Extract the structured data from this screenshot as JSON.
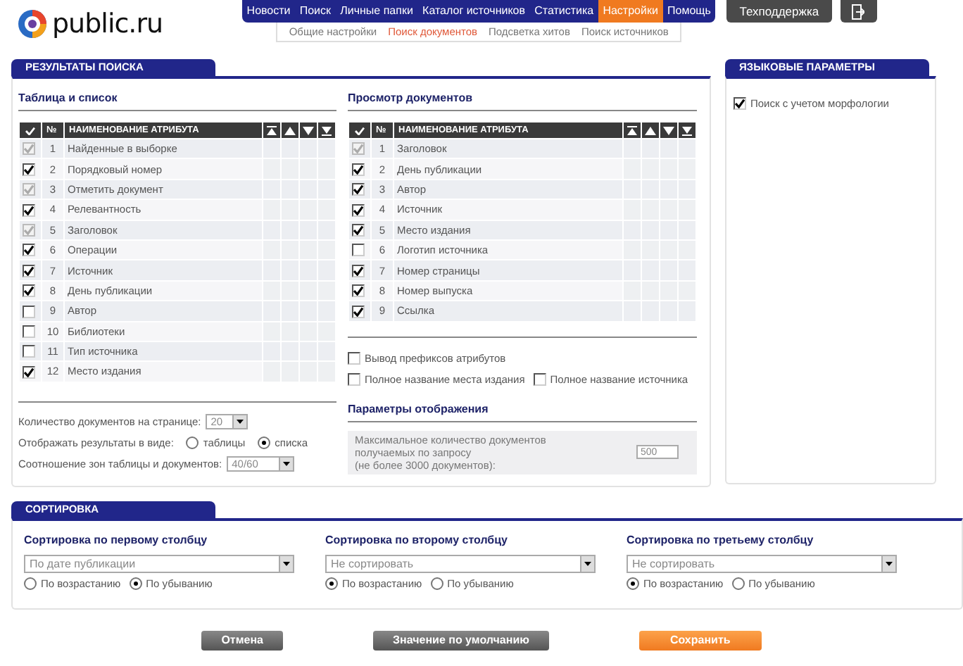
{
  "logo": {
    "text": "public.ru"
  },
  "nav": [
    {
      "label": "Новости",
      "selected": false
    },
    {
      "label": "Поиск",
      "selected": false
    },
    {
      "label": "Личные папки",
      "selected": false
    },
    {
      "label": "Каталог источников",
      "selected": false
    },
    {
      "label": "Статистика",
      "selected": false
    },
    {
      "label": "Настройки",
      "selected": true
    },
    {
      "label": "Помощь",
      "selected": false
    }
  ],
  "subnav": [
    {
      "label": "Общие настройки",
      "selected": false
    },
    {
      "label": "Поиск документов",
      "selected": true
    },
    {
      "label": "Подсветка хитов",
      "selected": false
    },
    {
      "label": "Поиск источников",
      "selected": false
    }
  ],
  "support_button": "Техподдержка",
  "results": {
    "title": "РЕЗУЛЬТАТЫ ПОИСКА",
    "tables": [
      {
        "heading": "Таблица и список",
        "columns": [
          "№",
          "НАИМЕНОВАНИЕ АТРИБУТА"
        ],
        "rows": [
          {
            "num": "1",
            "name": "Найденные в выборке",
            "checked": true,
            "disabled": true
          },
          {
            "num": "2",
            "name": "Порядковый номер",
            "checked": true,
            "disabled": false
          },
          {
            "num": "3",
            "name": "Отметить документ",
            "checked": true,
            "disabled": true
          },
          {
            "num": "4",
            "name": "Релевантность",
            "checked": true,
            "disabled": false
          },
          {
            "num": "5",
            "name": "Заголовок",
            "checked": true,
            "disabled": true
          },
          {
            "num": "6",
            "name": "Операции",
            "checked": true,
            "disabled": false
          },
          {
            "num": "7",
            "name": "Источник",
            "checked": true,
            "disabled": false
          },
          {
            "num": "8",
            "name": "День публикации",
            "checked": true,
            "disabled": false
          },
          {
            "num": "9",
            "name": "Автор",
            "checked": false,
            "disabled": false
          },
          {
            "num": "10",
            "name": "Библиотеки",
            "checked": false,
            "disabled": false
          },
          {
            "num": "11",
            "name": "Тип источника",
            "checked": false,
            "disabled": false
          },
          {
            "num": "12",
            "name": "Место издания",
            "checked": true,
            "disabled": false
          }
        ]
      },
      {
        "heading": "Просмотр документов",
        "columns": [
          "№",
          "НАИМЕНОВАНИЕ АТРИБУТА"
        ],
        "rows": [
          {
            "num": "1",
            "name": "Заголовок",
            "checked": true,
            "disabled": true
          },
          {
            "num": "2",
            "name": "День публикации",
            "checked": true,
            "disabled": false
          },
          {
            "num": "3",
            "name": "Автор",
            "checked": true,
            "disabled": false
          },
          {
            "num": "4",
            "name": "Источник",
            "checked": true,
            "disabled": false
          },
          {
            "num": "5",
            "name": "Место издания",
            "checked": true,
            "disabled": false
          },
          {
            "num": "6",
            "name": "Логотип источника",
            "checked": false,
            "disabled": false
          },
          {
            "num": "7",
            "name": "Номер страницы",
            "checked": true,
            "disabled": false
          },
          {
            "num": "8",
            "name": "Номер выпуска",
            "checked": true,
            "disabled": false
          },
          {
            "num": "9",
            "name": "Ссылка",
            "checked": true,
            "disabled": false
          }
        ]
      }
    ],
    "per_page": {
      "label": "Количество документов на странице:",
      "value": "20"
    },
    "view_mode": {
      "label": "Отображать результаты в виде:",
      "options": [
        {
          "label": "таблицы",
          "selected": false
        },
        {
          "label": "списка",
          "selected": true
        }
      ]
    },
    "ratio": {
      "label": "Соотношение зон таблицы и документов:",
      "value": "40/60"
    },
    "options": [
      {
        "label": "Вывод префиксов атрибутов",
        "checked": false
      },
      {
        "label": "Полное название места издания",
        "checked": false
      },
      {
        "label": "Полное название источника",
        "checked": false
      }
    ],
    "display": {
      "heading": "Параметры отображения",
      "label": "Максимальное количество документов\nполучаемых по запросу\n(не более 3000 документов):",
      "value": "500"
    }
  },
  "language": {
    "title": "ЯЗЫКОВЫЕ ПАРАМЕТРЫ",
    "options": [
      {
        "label": "Поиск с учетом морфологии",
        "checked": true
      }
    ]
  },
  "sorting": {
    "title": "СОРТИРОВКА",
    "columns": [
      {
        "heading": "Сортировка по первому столбцу",
        "value": "По дате публикации",
        "orders": [
          {
            "label": "По возрастанию",
            "selected": false
          },
          {
            "label": "По убыванию",
            "selected": true
          }
        ]
      },
      {
        "heading": "Сортировка по второму столбцу",
        "value": "Не сортировать",
        "orders": [
          {
            "label": "По возрастанию",
            "selected": true
          },
          {
            "label": "По убыванию",
            "selected": false
          }
        ]
      },
      {
        "heading": "Сортировка по третьему столбцу",
        "value": "Не сортировать",
        "orders": [
          {
            "label": "По возрастанию",
            "selected": true
          },
          {
            "label": "По убыванию",
            "selected": false
          }
        ]
      }
    ]
  },
  "buttons": [
    {
      "label": "Отмена",
      "kind": "cancel"
    },
    {
      "label": "Значение по умолчанию",
      "kind": "default"
    },
    {
      "label": "Сохранить",
      "kind": "save"
    }
  ]
}
